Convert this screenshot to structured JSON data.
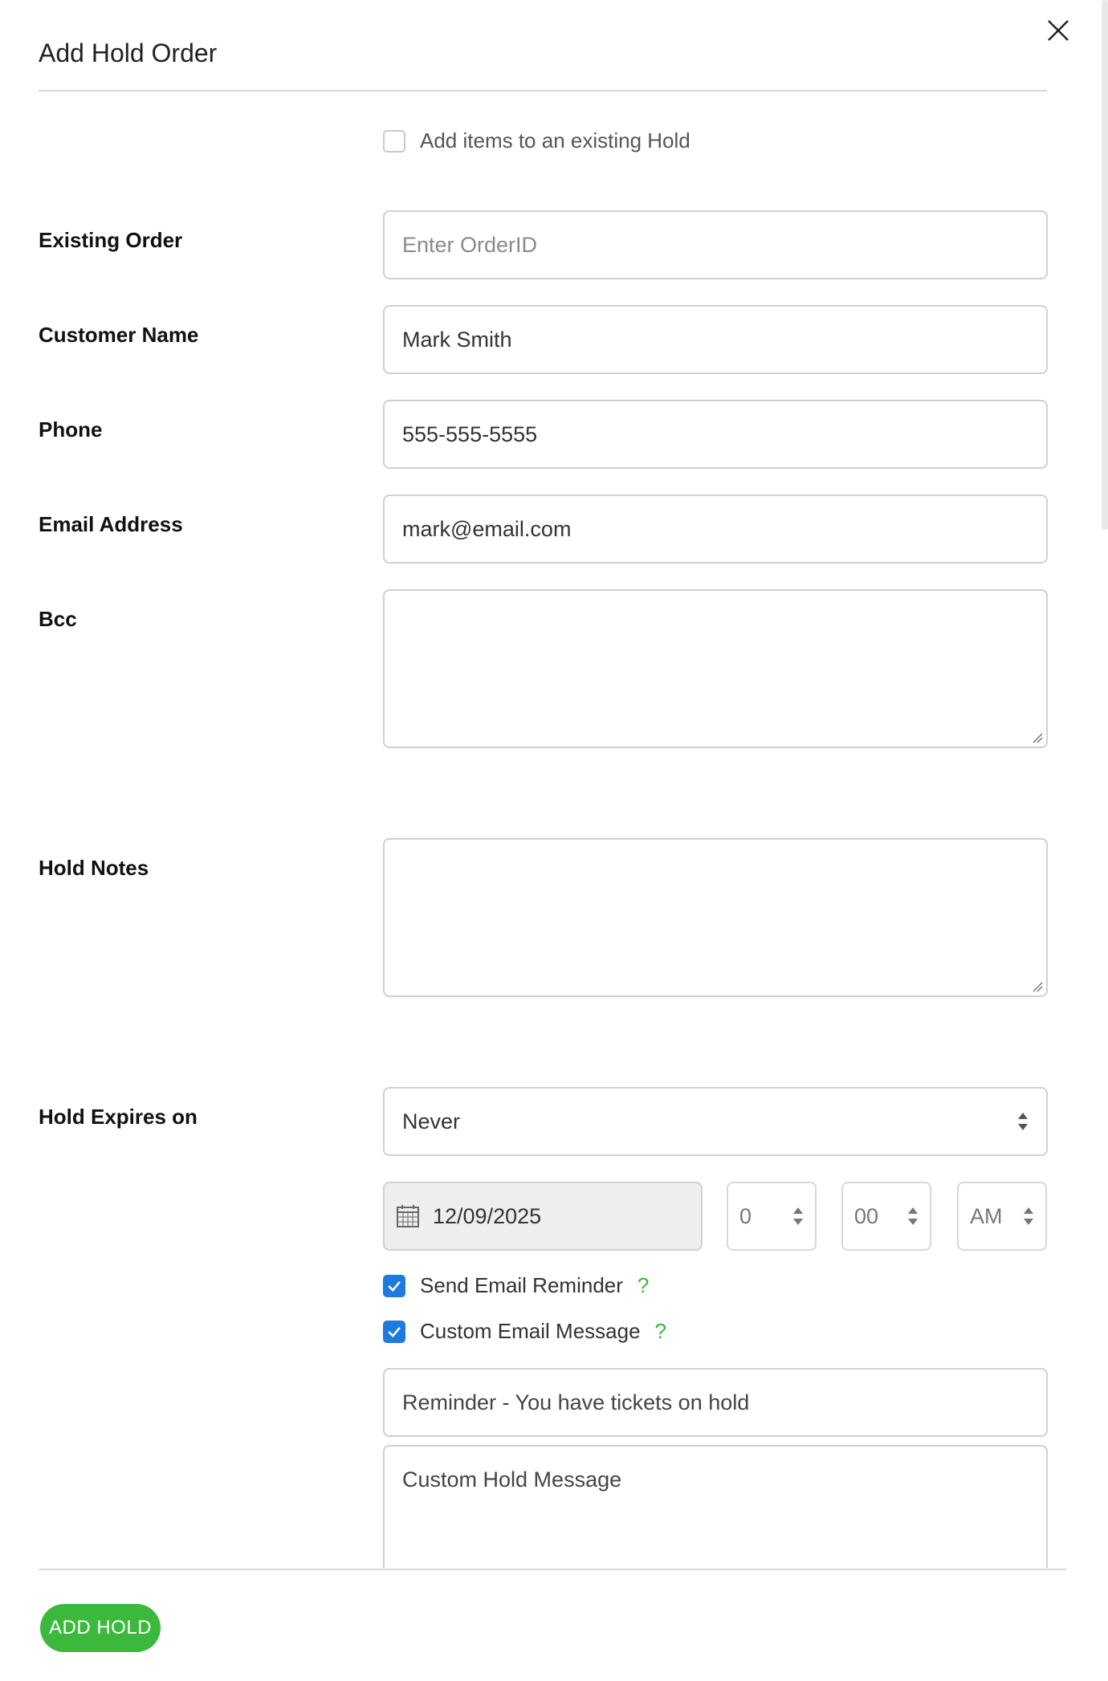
{
  "dialog": {
    "title": "Add Hold Order",
    "close_icon": "close-icon"
  },
  "existing_hold": {
    "label": "Add items to an existing Hold",
    "checked": false
  },
  "fields": {
    "existing_order": {
      "label": "Existing Order",
      "placeholder": "Enter OrderID",
      "value": ""
    },
    "customer_name": {
      "label": "Customer Name",
      "value": "Mark Smith"
    },
    "phone": {
      "label": "Phone",
      "value": "555-555-5555"
    },
    "email": {
      "label": "Email Address",
      "value": "mark@email.com"
    },
    "bcc": {
      "label": "Bcc",
      "value": ""
    },
    "hold_notes": {
      "label": "Hold Notes",
      "value": ""
    },
    "hold_expires": {
      "label": "Hold Expires on",
      "value": "Never"
    }
  },
  "expiry": {
    "date": "12/09/2025",
    "hour": "0",
    "minute": "00",
    "ampm": "AM",
    "calendar_icon": "calendar-icon"
  },
  "reminders": {
    "send_email_reminder": {
      "label": "Send Email Reminder",
      "checked": true,
      "help": "?"
    },
    "custom_email_message": {
      "label": "Custom Email Message",
      "checked": true,
      "help": "?"
    },
    "subject": "Reminder - You have tickets on hold",
    "message_placeholder": "Custom Hold Message"
  },
  "footer": {
    "add_button": "ADD HOLD"
  },
  "colors": {
    "accent_green": "#3cb93c",
    "checkbox_blue": "#1f7ae0"
  }
}
